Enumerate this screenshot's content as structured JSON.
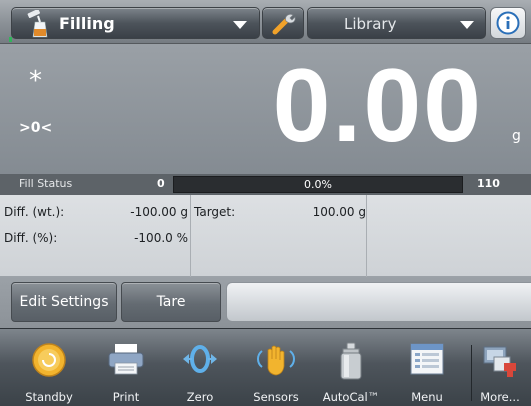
{
  "topbar": {
    "application": "Filling",
    "library": "Library",
    "icons": {
      "application": "filling-bottle-icon",
      "settings": "wrench-icon",
      "info": "info-icon"
    }
  },
  "display": {
    "stable_marker": "*",
    "zero_indicator": ">0<",
    "weight": "0.00",
    "unit": "g"
  },
  "fill_status": {
    "label": "Fill Status",
    "min": "0",
    "percent_label": "0.0%",
    "percent_value": 0.0,
    "max": "110"
  },
  "fields": {
    "diff_wt_label": "Diff. (wt.):",
    "diff_wt_value": "-100.00 g",
    "diff_pct_label": "Diff. (%):",
    "diff_pct_value": "-100.0 %",
    "target_label": "Target:",
    "target_value": "100.00 g"
  },
  "actions": {
    "edit_settings": "Edit Settings",
    "tare": "Tare"
  },
  "nav": [
    {
      "label": "Standby",
      "icon": "standby-icon"
    },
    {
      "label": "Print",
      "icon": "printer-icon"
    },
    {
      "label": "Zero",
      "icon": "zero-icon"
    },
    {
      "label": "Sensors",
      "icon": "sensors-hand-icon"
    },
    {
      "label": "AutoCal™",
      "icon": "calibration-weight-icon"
    },
    {
      "label": "Menu",
      "icon": "menu-window-icon"
    },
    {
      "label": "More...",
      "icon": "more-icon"
    }
  ],
  "colors": {
    "fill_bar": "#2ea84d",
    "accent_orange": "#f0a81e",
    "info_blue": "#2a6fb8"
  }
}
